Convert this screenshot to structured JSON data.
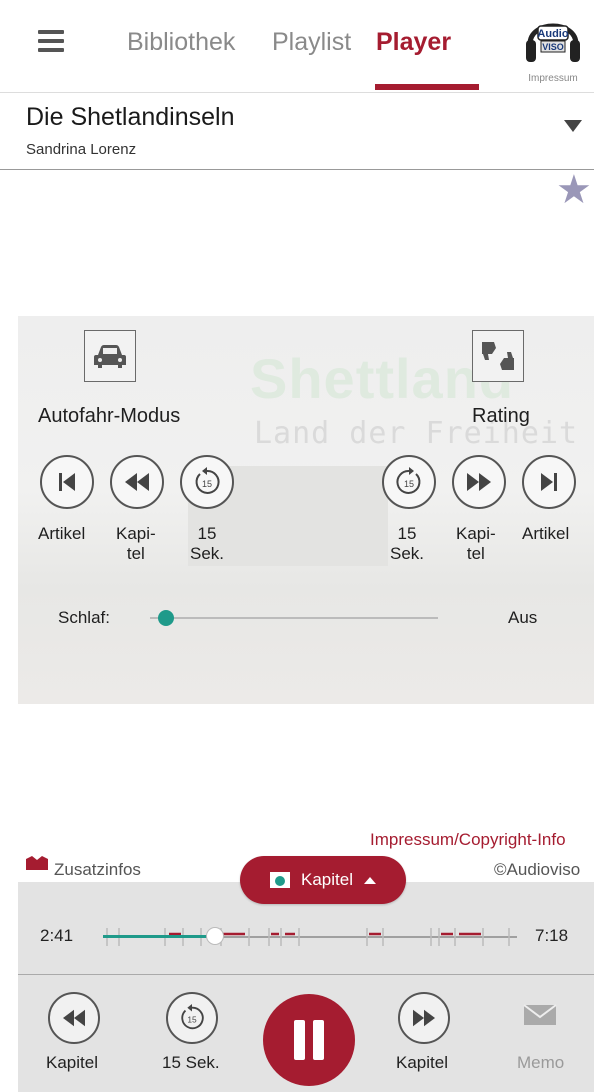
{
  "nav": {
    "tabs": [
      {
        "label": "Bibliothek",
        "active": false
      },
      {
        "label": "Playlist",
        "active": false
      },
      {
        "label": "Player",
        "active": true
      }
    ],
    "logo_text": "Audio VISO",
    "logo_subtitle": "Impressum"
  },
  "book": {
    "title": "Die Shetlandinseln",
    "author": "Sandrina Lorenz"
  },
  "panel": {
    "bg_title": "Shettland",
    "bg_subtitle": "Land der Freiheit",
    "car_mode_label": "Autofahr-Modus",
    "rating_label": "Rating",
    "left_controls": [
      {
        "label": "Artikel",
        "icon": "skip-to-start-icon"
      },
      {
        "label": "Kapi-\ntel",
        "icon": "rewind-icon"
      },
      {
        "label": "15\nSek.",
        "icon": "replay-15-icon"
      }
    ],
    "right_controls": [
      {
        "label": "15\nSek.",
        "icon": "forward-15-icon"
      },
      {
        "label": "Kapi-\ntel",
        "icon": "fast-forward-icon"
      },
      {
        "label": "Artikel",
        "icon": "skip-to-end-icon"
      }
    ],
    "skip_seconds_badge": "15",
    "sleep_label": "Schlaf:",
    "sleep_value": "Aus"
  },
  "info": {
    "impressum": "Impressum/Copyright-Info",
    "copyright": "©Audioviso",
    "zusatzinfos": "Zusatzinfos"
  },
  "player": {
    "kapitel_button": "Kapitel",
    "elapsed": "2:41",
    "total": "7:18",
    "progress_fraction": 0.27,
    "controls": [
      {
        "label": "Kapitel",
        "icon": "rewind-icon"
      },
      {
        "label": "15 Sek.",
        "icon": "replay-15-icon"
      },
      {
        "label": "",
        "icon": "pause-icon"
      },
      {
        "label": "Kapitel",
        "icon": "fast-forward-icon"
      },
      {
        "label": "Memo",
        "icon": "mail-icon"
      }
    ]
  },
  "colors": {
    "accent": "#a51c30",
    "teal": "#1f9a8a",
    "star": "#9a97b8"
  }
}
